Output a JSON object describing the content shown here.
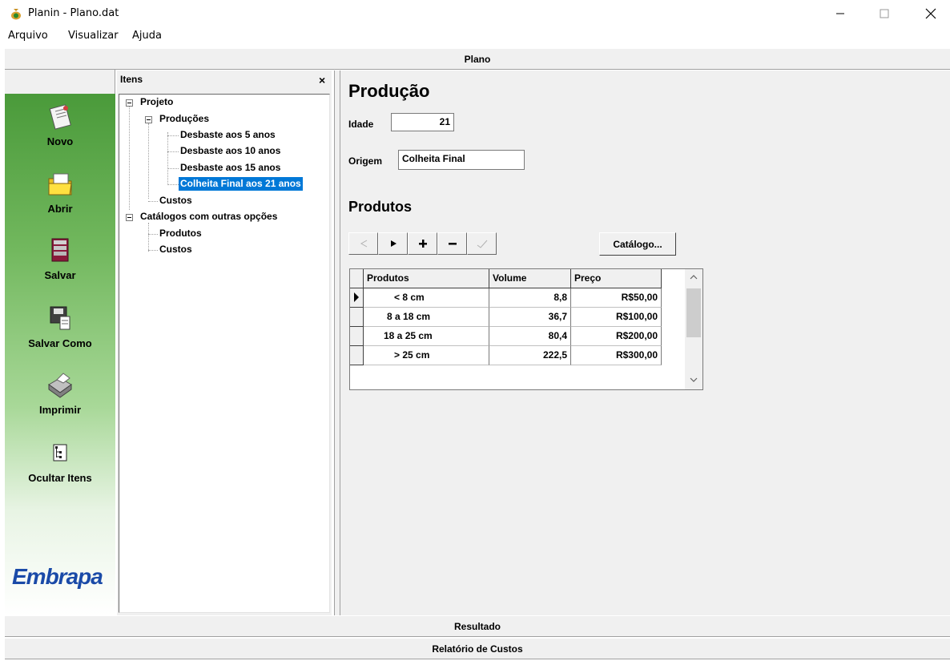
{
  "window": {
    "title": "Planin - Plano.dat",
    "minimize_icon": "minimize-icon",
    "maximize_icon": "maximize-icon",
    "close_icon": "close-icon"
  },
  "menu": [
    "Arquivo",
    "Visualizar",
    "Ajuda"
  ],
  "sections": {
    "plano": "Plano",
    "resultado": "Resultado",
    "relatorio": "Relatório de Custos"
  },
  "toolbar": [
    {
      "label": "Novo",
      "icon": "new-document-icon"
    },
    {
      "label": "Abrir",
      "icon": "open-folder-icon"
    },
    {
      "label": "Salvar",
      "icon": "save-book-icon"
    },
    {
      "label": "Salvar Como",
      "icon": "save-as-icon"
    },
    {
      "label": "Imprimir",
      "icon": "printer-icon"
    },
    {
      "label": "Ocultar Itens",
      "icon": "tree-icon"
    }
  ],
  "logo": "Embrapa",
  "items_panel": {
    "header": "Itens",
    "close": "×",
    "tree": [
      {
        "label": "Projeto"
      },
      {
        "label": "Produções"
      },
      {
        "label": "Desbaste aos 5 anos"
      },
      {
        "label": "Desbaste aos 10 anos"
      },
      {
        "label": "Desbaste aos 15 anos"
      },
      {
        "label": "Colheita Final aos 21 anos",
        "selected": true
      },
      {
        "label": "Custos"
      },
      {
        "label": "Catálogos com outras opções"
      },
      {
        "label": "Produtos"
      },
      {
        "label": "Custos"
      }
    ]
  },
  "main": {
    "title": "Produção",
    "idade_label": "Idade",
    "idade_value": "21",
    "origem_label": "Origem",
    "origem_value": "Colheita Final",
    "produtos_title": "Produtos",
    "nav_buttons": [
      {
        "symbol": "◄",
        "icon": "first-record-icon",
        "enabled": false
      },
      {
        "symbol": "►",
        "icon": "next-record-icon",
        "enabled": true
      },
      {
        "symbol": "+",
        "icon": "add-record-icon",
        "enabled": true
      },
      {
        "symbol": "−",
        "icon": "delete-record-icon",
        "enabled": true
      },
      {
        "symbol": "✓",
        "icon": "confirm-record-icon",
        "enabled": false
      }
    ],
    "catalogo_button": "Catálogo...",
    "grid": {
      "columns": [
        "Produtos",
        "Volume",
        "Preço"
      ],
      "rows": [
        [
          "< 8 cm",
          "8,8",
          "R$50,00"
        ],
        [
          "8 a 18 cm",
          "36,7",
          "R$100,00"
        ],
        [
          "18 a 25 cm",
          "80,4",
          "R$200,00"
        ],
        [
          "> 25 cm",
          "222,5",
          "R$300,00"
        ]
      ],
      "current_row": 0
    }
  },
  "colors": {
    "selection": "#0078d7",
    "logo_blue": "#1a4aa8",
    "toolbar_green": "#4a9a3a"
  }
}
